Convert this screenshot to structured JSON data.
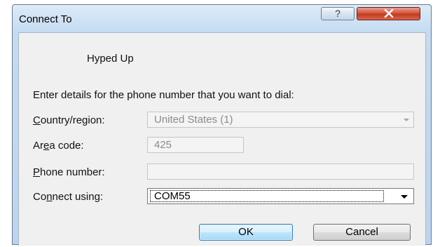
{
  "window": {
    "title": "Connect To",
    "help_glyph": "?",
    "close_icon": "close-icon"
  },
  "entry_name": "Hyped Up",
  "instruction": "Enter details for the phone number that you want to dial:",
  "fields": {
    "country": {
      "label_pre": "",
      "label_key": "C",
      "label_post": "ountry/region:",
      "value": "United States (1)",
      "enabled": false
    },
    "area_code": {
      "label_pre": "Ar",
      "label_key": "e",
      "label_post": "a code:",
      "value": "425",
      "enabled": false
    },
    "phone_number": {
      "label_pre": "",
      "label_key": "P",
      "label_post": "hone number:",
      "value": "",
      "enabled": false
    },
    "connect_using": {
      "label_pre": "Co",
      "label_key": "n",
      "label_post": "nect using:",
      "value": "COM55",
      "enabled": true
    }
  },
  "buttons": {
    "ok": "OK",
    "cancel": "Cancel"
  },
  "colors": {
    "close_button": "#c13a20",
    "ok_border": "#3c7fb1",
    "client_bg": "#f0f0f0"
  }
}
